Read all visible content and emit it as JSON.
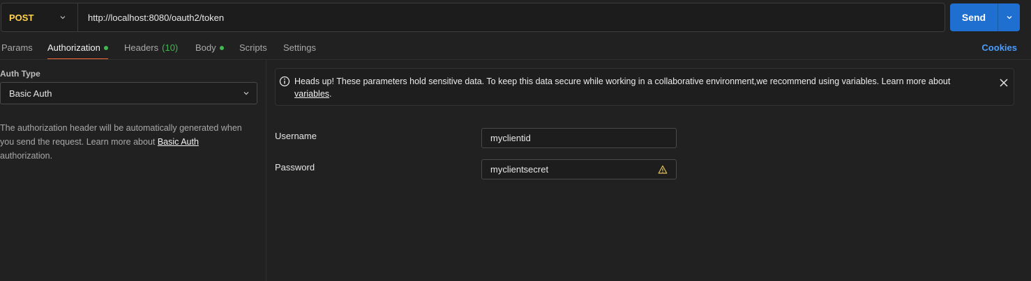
{
  "request": {
    "method": "POST",
    "url": "http://localhost:8080/oauth2/token",
    "send_label": "Send"
  },
  "tabs": [
    {
      "label": "Params"
    },
    {
      "label": "Authorization",
      "active": true,
      "indicator": "green-dot"
    },
    {
      "label": "Headers",
      "count": "(10)"
    },
    {
      "label": "Body",
      "indicator": "green-dot"
    },
    {
      "label": "Scripts"
    },
    {
      "label": "Settings"
    }
  ],
  "cookies_label": "Cookies",
  "auth": {
    "type_label": "Auth Type",
    "type_value": "Basic Auth",
    "description": "The authorization header will be automatically generated when you send the request. Learn more about ",
    "description_link": "Basic Auth",
    "description_suffix": " authorization."
  },
  "notice": {
    "text": "Heads up! These parameters hold sensitive data. To keep this data secure while working in a collaborative environment,we recommend using variables. Learn more about ",
    "link": "variables",
    "suffix": "."
  },
  "fields": {
    "username_label": "Username",
    "username_value": "myclientid",
    "password_label": "Password",
    "password_value": "myclientsecret"
  },
  "colors": {
    "method": "#ffd34d",
    "send": "#1f6fd1",
    "active_tab_underline": "#ff6c37",
    "indicator": "#3fb950",
    "cookies": "#4a9eff",
    "warning": "#e3c45a"
  }
}
